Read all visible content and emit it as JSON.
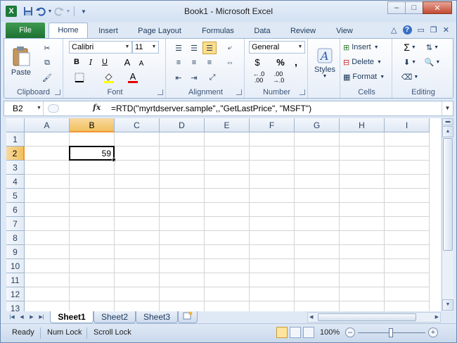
{
  "window": {
    "title": "Book1 - Microsoft Excel",
    "app_icon": "X",
    "minimize": "–",
    "maximize": "□",
    "close": "✕"
  },
  "qat": {
    "icons": [
      "save-icon",
      "undo-icon",
      "redo-icon",
      "customize-icon"
    ]
  },
  "ribbon_tabs": {
    "file": "File",
    "tabs": [
      "Home",
      "Insert",
      "Page Layout",
      "Formulas",
      "Data",
      "Review",
      "View"
    ],
    "active": "Home"
  },
  "ribbon": {
    "clipboard": {
      "label": "Clipboard",
      "paste": "Paste"
    },
    "font": {
      "label": "Font",
      "family": "Calibri",
      "size": "11",
      "bold": "B",
      "italic": "I",
      "underline": "U",
      "grow": "A",
      "shrink": "A",
      "color": "A"
    },
    "alignment": {
      "label": "Alignment"
    },
    "number": {
      "label": "Number",
      "format": "General",
      "currency": "$",
      "percent": "%",
      "comma": ",",
      "inc": "←.0 .00",
      "dec": ".00 →.0"
    },
    "styles": {
      "label": "Styles",
      "button": "Styles"
    },
    "cells": {
      "label": "Cells",
      "insert": "Insert",
      "delete": "Delete",
      "format": "Format"
    },
    "editing": {
      "label": "Editing",
      "sum": "Σ"
    }
  },
  "formula_bar": {
    "name_box": "B2",
    "fx": "fx",
    "formula": "=RTD(\"myrtdserver.sample\",,\"GetLastPrice\", \"MSFT\")"
  },
  "grid": {
    "columns": [
      "A",
      "B",
      "C",
      "D",
      "E",
      "F",
      "G",
      "H",
      "I"
    ],
    "rows": [
      "1",
      "2",
      "3",
      "4",
      "5",
      "6",
      "7",
      "8",
      "9",
      "10",
      "11",
      "12",
      "13"
    ],
    "selected_col": "B",
    "selected_row": "2",
    "active_cell_value": "59"
  },
  "sheets": {
    "tabs": [
      "Sheet1",
      "Sheet2",
      "Sheet3"
    ],
    "active": "Sheet1"
  },
  "status": {
    "ready": "Ready",
    "num_lock": "Num Lock",
    "scroll_lock": "Scroll Lock",
    "zoom": "100%",
    "zoom_out": "–",
    "zoom_in": "+"
  },
  "colors": {
    "file_tab": "#1e7132",
    "selected_header": "#f1c15f",
    "ribbon_border": "#9ab4d6"
  }
}
